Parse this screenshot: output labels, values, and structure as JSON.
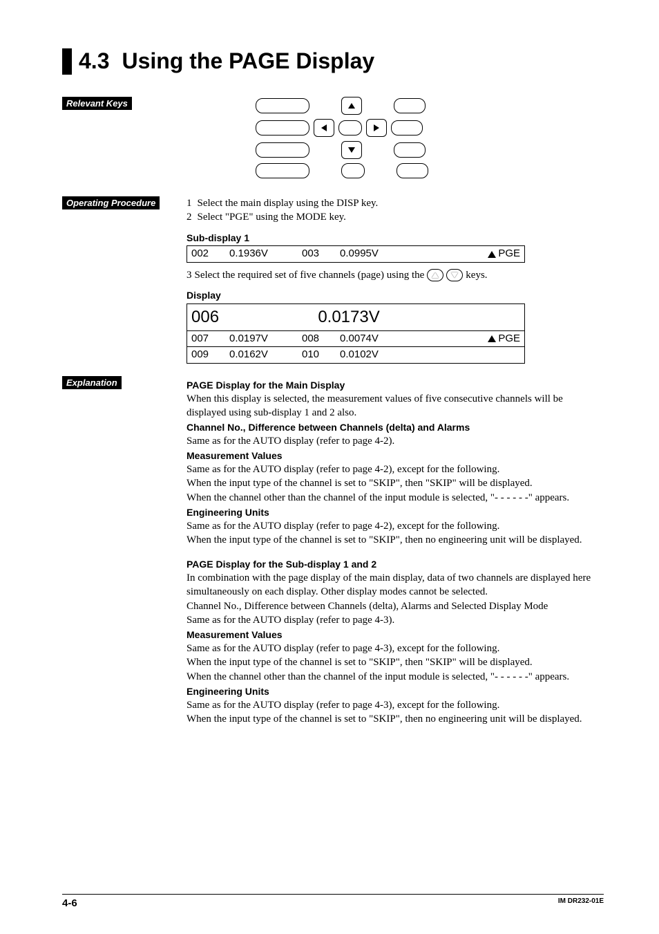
{
  "title": {
    "number": "4.3",
    "text": "Using the PAGE Display"
  },
  "labels": {
    "relevant_keys": "Relevant Keys",
    "operating_procedure": "Operating Procedure",
    "explanation": "Explanation"
  },
  "procedure": {
    "s1_num": "1",
    "s1": "Select the main display using the DISP key.",
    "s2_num": "2",
    "s2": "Select \"PGE\" using the MODE key.",
    "s3_num": "3",
    "s3a": "Select the required set of five channels (page) using the",
    "s3b": "keys."
  },
  "subdisplay1": {
    "label": "Sub-display 1",
    "row": {
      "ch1": "002",
      "v1": "0.1936V",
      "ch2": "003",
      "v2": "0.0995V",
      "mode": "PGE"
    }
  },
  "display": {
    "label": "Display",
    "main": {
      "ch": "006",
      "val": "0.0173V"
    },
    "r1": {
      "ch1": "007",
      "v1": "0.0197V",
      "ch2": "008",
      "v2": "0.0074V",
      "mode": "PGE"
    },
    "r2": {
      "ch1": "009",
      "v1": "0.0162V",
      "ch2": "010",
      "v2": "0.0102V"
    }
  },
  "explanation": {
    "h1": "PAGE Display for the Main Display",
    "p1": "When this display is selected, the measurement values of five consecutive channels will be displayed using sub-display 1 and 2 also.",
    "sh1": "Channel No., Difference between Channels (delta) and Alarms",
    "p2": "Same as for the AUTO display (refer to page 4-2).",
    "sh2": "Measurement Values",
    "p3": "Same as for the AUTO display (refer to page 4-2), except for the following.",
    "p4": "When the input type of the channel is set to \"SKIP\", then \"SKIP\" will be displayed.",
    "p5": "When the channel other than the channel of the input module is selected, \"- - - - - -\" appears.",
    "sh3": "Engineering Units",
    "p6": "Same as for the AUTO display (refer to page 4-2), except for the following.",
    "p7": "When the input type of the channel is set to \"SKIP\", then no engineering unit will be displayed.",
    "h2": "PAGE Display for the Sub-display 1 and 2",
    "p8": "In combination with the page display of the main display, data of two channels are displayed here simultaneously on each display. Other display modes cannot be selected.",
    "p9": "Channel No., Difference between Channels (delta), Alarms and Selected Display Mode",
    "p10": "Same as for the AUTO display (refer to page 4-3).",
    "sh4": "Measurement Values",
    "p11": "Same as for the AUTO display (refer to page 4-3), except for the following.",
    "p12": "When the input type of the channel is set to \"SKIP\", then \"SKIP\" will be displayed.",
    "p13": "When the channel other than the channel of the input module is selected, \"- - - - - -\" appears.",
    "sh5": "Engineering Units",
    "p14": "Same as for the AUTO display (refer to page 4-3), except for the following.",
    "p15": "When the input type of the channel is set to \"SKIP\", then no engineering unit will be displayed."
  },
  "footer": {
    "page": "4-6",
    "doc": "IM DR232-01E"
  }
}
